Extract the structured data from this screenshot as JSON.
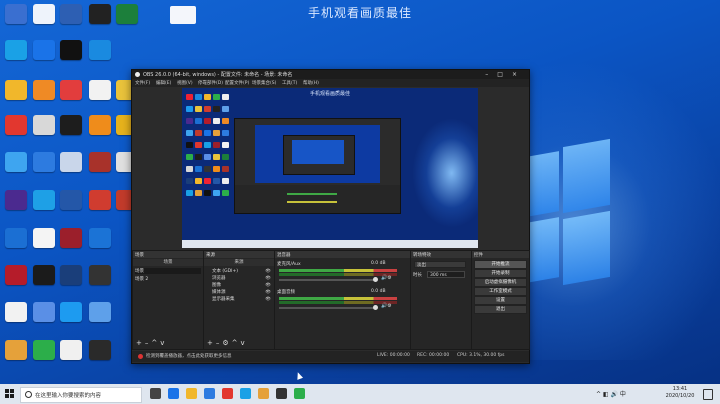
{
  "watermark": "手机观看画质最佳",
  "obs": {
    "title": "OBS 26.0.0 (64-bit, windows) - 配置文件: 未命名 - 场景: 未命名",
    "menu": [
      "文件(F)",
      "编辑(E)",
      "视图(V)",
      "停靠部件(D)",
      "配置文件(P)",
      "场景集合(S)",
      "工具(T)",
      "帮助(H)"
    ],
    "preview_caption": "手机观看画质最佳",
    "docks": {
      "scenes": {
        "title": "场景",
        "header": "场景",
        "items": [
          "场景",
          "场景 2"
        ]
      },
      "sources": {
        "title": "来源",
        "header": "来源",
        "items": [
          "文本 (GDI+)",
          "浏览器",
          "图像",
          "媒体源",
          "显示器采集"
        ]
      },
      "mixer": {
        "title": "混音器",
        "channels": [
          {
            "name": "麦克风/Aux",
            "db": "0.0 dB"
          },
          {
            "name": "桌面音频",
            "db": "0.0 dB"
          }
        ]
      },
      "transitions": {
        "title": "转场特效",
        "type": "淡出",
        "duration_label": "时长",
        "duration": "300 ms"
      },
      "controls": {
        "title": "控件",
        "buttons": [
          "开始推流",
          "开始录制",
          "启动虚拟摄像机",
          "工作室模式",
          "设置",
          "退出"
        ]
      }
    },
    "status": {
      "message": "检测到覆盖播放器，点击此处获取更多信息",
      "live": "LIVE: 00:00:00",
      "rec": "REC: 00:00:00",
      "cpu": "CPU: 3.1%, 30.00 fps"
    }
  },
  "taskbar": {
    "search_placeholder": "在这里输入你要搜索的内容",
    "time": "13:41",
    "date": "2020/10/20"
  }
}
